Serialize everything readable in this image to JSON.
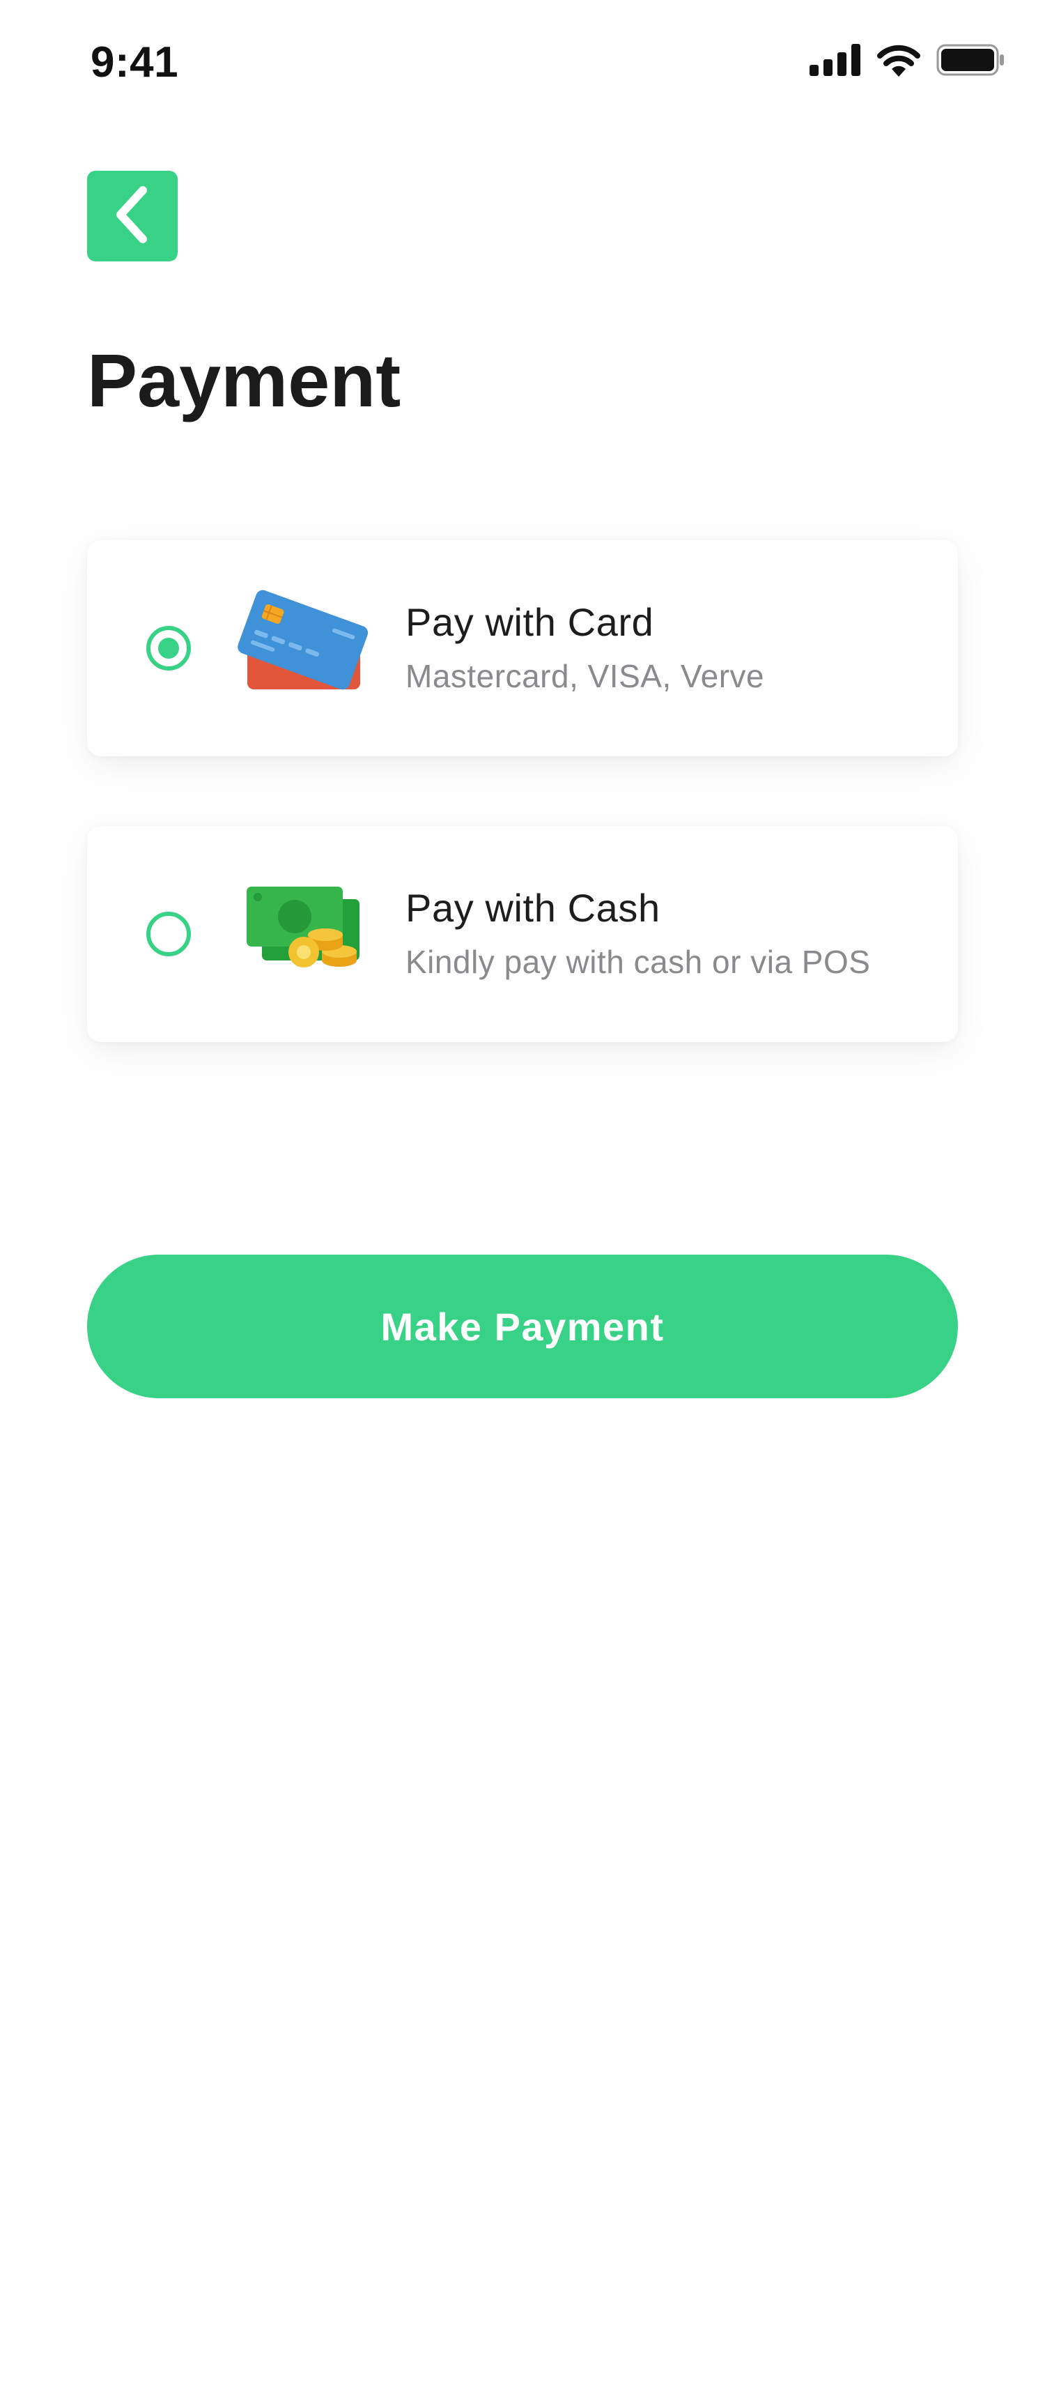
{
  "colors": {
    "accent": "#38d286",
    "text_primary": "#1d1d1f",
    "text_secondary": "#8a8a8e",
    "background": "#ffffff"
  },
  "status_bar": {
    "time": "9:41",
    "icons": [
      "cellular-signal-icon",
      "wifi-icon",
      "battery-icon"
    ]
  },
  "header": {
    "back_icon": "chevron-left-icon",
    "title": "Payment"
  },
  "payment_options": [
    {
      "title": "Pay with Card",
      "subtitle": "Mastercard, VISA, Verve",
      "icon": "credit-card-icon",
      "selected": true
    },
    {
      "title": "Pay with Cash",
      "subtitle": "Kindly pay with cash or via POS",
      "icon": "cash-coins-icon",
      "selected": false
    }
  ],
  "actions": {
    "make_payment_label": "Make Payment"
  }
}
